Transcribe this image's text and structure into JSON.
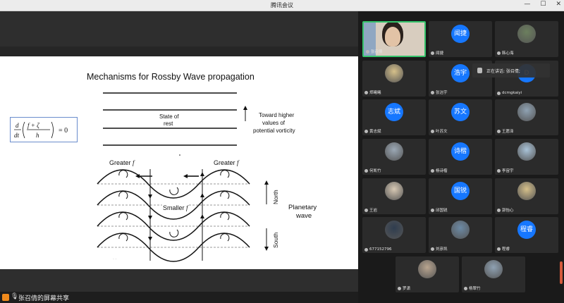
{
  "window": {
    "title": "腾讯会议"
  },
  "slide": {
    "title": "Mechanisms for Rossby Wave propagation",
    "eq": {
      "d": "d",
      "dt": "dt",
      "num": "f + ζ",
      "den": "h",
      "eq": "= 0"
    },
    "state": "State of",
    "rest": "rest",
    "higher": [
      "Toward higher",
      "values of",
      "potential vorticity"
    ],
    "greater": "Greater",
    "f": "f",
    "smaller": "Smaller",
    "north": "North",
    "south": "South",
    "planetary": [
      "Planetary",
      "wave"
    ]
  },
  "share_bar": {
    "label": "张召倩的屏幕共享"
  },
  "speaking": {
    "label": "正在讲话: 张召倩;"
  },
  "participants": [
    {
      "name": "张召倩",
      "kind": "camera"
    },
    {
      "name": "闻捷",
      "kind": "text",
      "avatar": "闻捷"
    },
    {
      "name": "韩心海",
      "kind": "pic"
    },
    {
      "name": "郑曦曦",
      "kind": "pic"
    },
    {
      "name": "张洁宇",
      "kind": "text",
      "avatar": "浩宇"
    },
    {
      "name": "dcmgkaiyi",
      "kind": "text",
      "avatar": "D"
    },
    {
      "name": "黄志斌",
      "kind": "text",
      "avatar": "志斌"
    },
    {
      "name": "叶苏文",
      "kind": "text",
      "avatar": "苏文"
    },
    {
      "name": "王愿泽",
      "kind": "pic"
    },
    {
      "name": "何凯竹",
      "kind": "pic"
    },
    {
      "name": "杨诗楷",
      "kind": "text",
      "avatar": "诗楷"
    },
    {
      "name": "李宙宇",
      "kind": "pic"
    },
    {
      "name": "王岩",
      "kind": "pic"
    },
    {
      "name": "邱国锐",
      "kind": "text",
      "avatar": "国锐"
    },
    {
      "name": "郭怡心",
      "kind": "pic"
    },
    {
      "name": "677152796",
      "kind": "pic"
    },
    {
      "name": "刘彦凯",
      "kind": "pic"
    },
    {
      "name": "程睿",
      "kind": "text",
      "avatar": "程睿"
    },
    {
      "name": "罗潇",
      "kind": "pic"
    },
    {
      "name": "杨翠竹",
      "kind": "pic"
    }
  ]
}
